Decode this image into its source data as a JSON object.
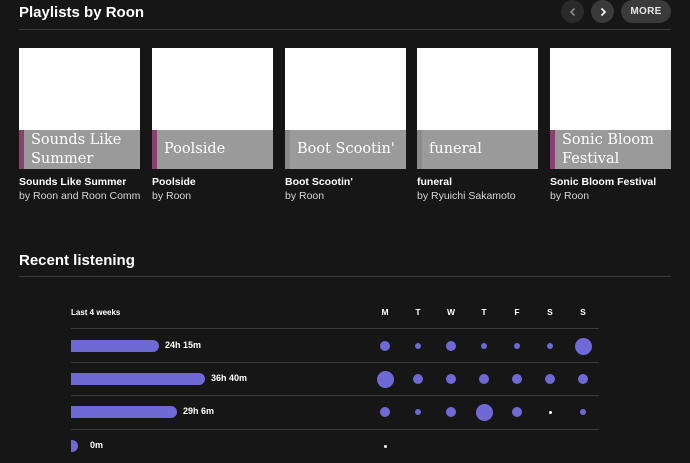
{
  "playlists": {
    "title": "Playlists by Roon",
    "more_label": "MORE",
    "cards": [
      {
        "art_title": "Sounds Like Summer",
        "name": "Sounds Like Summer",
        "owner": "by Roon and Roon Comm",
        "stripe_color": "#8a3f6f"
      },
      {
        "art_title": "Poolside",
        "name": "Poolside",
        "owner": "by Roon",
        "stripe_color": "#8a3f6f"
      },
      {
        "art_title": "Boot Scootin'",
        "name": "Boot Scootin'",
        "owner": "by Roon",
        "stripe_color": "#8a8a8a"
      },
      {
        "art_title": "funeral",
        "name": "funeral",
        "owner": "by Ryuichi Sakamoto",
        "stripe_color": "#8a8a8a"
      },
      {
        "art_title": "Sonic Bloom Festival",
        "name": "Sonic Bloom Festival",
        "owner": "by Roon",
        "stripe_color": "#8a3f6f"
      }
    ]
  },
  "recent": {
    "title": "Recent listening",
    "period_label": "Last 4 weeks",
    "days": [
      "M",
      "T",
      "W",
      "T",
      "F",
      "S",
      "S"
    ],
    "weeks": [
      {
        "total": "24h 15m",
        "fraction": 0.66,
        "daily": [
          2,
          1,
          2,
          1,
          1,
          1,
          3
        ]
      },
      {
        "total": "36h 40m",
        "fraction": 1.0,
        "daily": [
          3,
          2,
          2,
          2,
          2,
          2,
          2
        ]
      },
      {
        "total": "29h 6m",
        "fraction": 0.79,
        "daily": [
          2,
          1,
          2,
          3,
          2,
          0,
          1
        ]
      },
      {
        "total": "0m",
        "fraction": 0.0,
        "daily": [
          0,
          null,
          null,
          null,
          null,
          null,
          null
        ]
      }
    ]
  },
  "colors": {
    "accent": "#6f69d6",
    "background": "#161616"
  }
}
